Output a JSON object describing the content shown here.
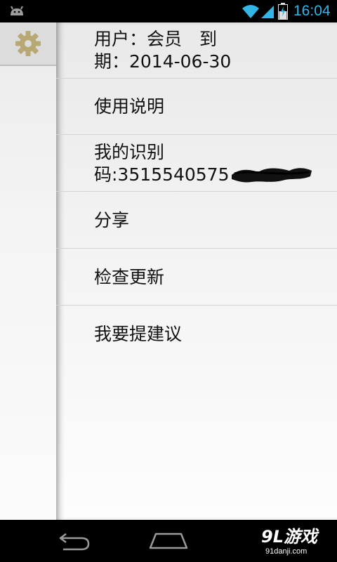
{
  "status_bar": {
    "time": "16:04",
    "icons": [
      "android-debug-icon",
      "wifi-icon",
      "signal-icon",
      "battery-charging-icon"
    ],
    "time_color": "#33b5e5"
  },
  "sidebar": {
    "settings_icon": "gear-icon",
    "gear_color": "#b8a874"
  },
  "menu": {
    "items": [
      {
        "lines": [
          "用户：会员　到",
          "期：2014-06-30"
        ]
      },
      {
        "lines": [
          "使用说明"
        ]
      },
      {
        "lines": [
          "我的识别",
          "码:3515540575"
        ]
      },
      {
        "lines": [
          "分享"
        ]
      },
      {
        "lines": [
          "检查更新"
        ]
      },
      {
        "lines": [
          "我要提建议"
        ]
      }
    ]
  },
  "nav_bar": {
    "icons": [
      "back-icon",
      "home-icon"
    ],
    "watermark": {
      "main": "9L游戏",
      "sub": "91danji.com"
    }
  }
}
